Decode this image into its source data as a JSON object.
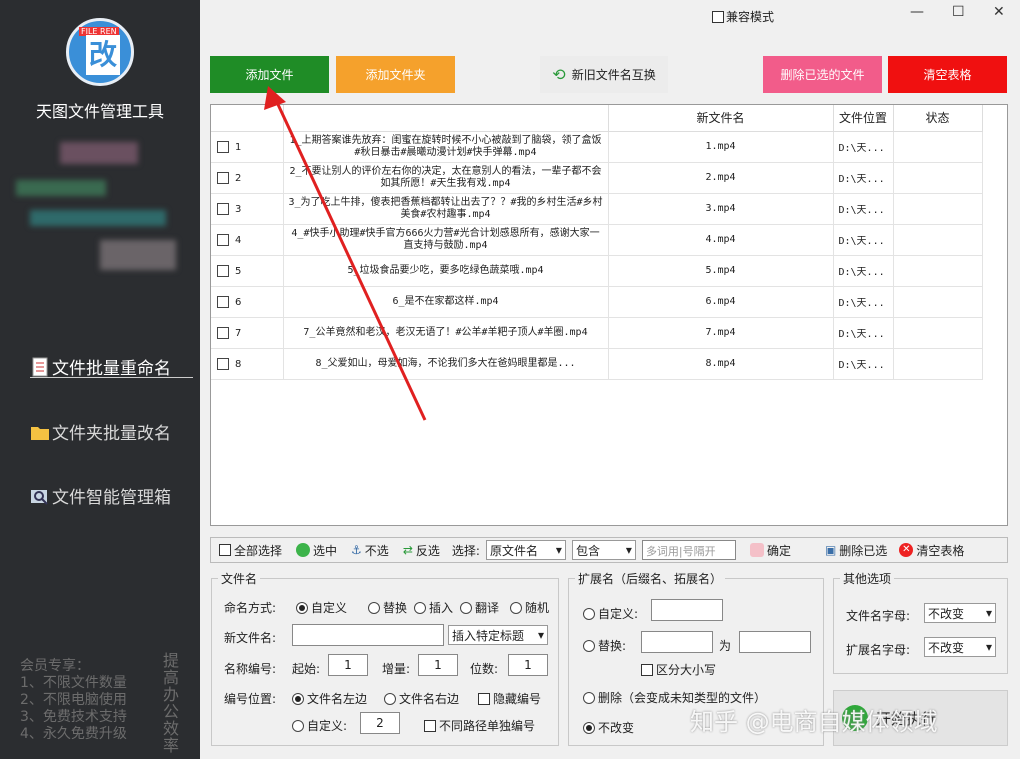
{
  "app": {
    "logo_tag": "FILE REN",
    "logo_char": "改",
    "title": "天图文件管理工具"
  },
  "nav": [
    {
      "label": "文件批量重命名"
    },
    {
      "label": "文件夹批量改名"
    },
    {
      "label": "文件智能管理箱"
    }
  ],
  "member": {
    "lines": [
      "会员专享：",
      "1、不限文件数量",
      "2、不限电脑使用",
      "3、免费技术支持",
      "4、永久免费升级"
    ],
    "side": "提高办公效率"
  },
  "window": {
    "compat": "兼容模式",
    "min": "—",
    "max": "☐",
    "close": "✕"
  },
  "buttons": {
    "add_file": "添加文件",
    "add_folder": "添加文件夹",
    "swap": "新旧文件名互换",
    "delete_selected": "删除已选的文件",
    "clear": "清空表格"
  },
  "colors": {
    "add_file": "#1f8c26",
    "add_folder": "#f5a12c",
    "delete_selected": "#f25c8a",
    "clear": "#f01010"
  },
  "table": {
    "headers": [
      "",
      "新文件名",
      "文件位置",
      "状态"
    ],
    "rows": [
      {
        "n": "1",
        "orig": "1_上期答案谁先放弃：闺蜜在旋转时候不小心被敲到了脑袋，领了盒饭#秋日暴击#晨曦动漫计划#快手弹幕.mp4",
        "new": "1.mp4",
        "loc": "D:\\天...",
        "status": ""
      },
      {
        "n": "2",
        "orig": "2_不要让别人的评价左右你的决定，太在意别人的看法，一辈子都不会如其所愿！#天生我有戏.mp4",
        "new": "2.mp4",
        "loc": "D:\\天...",
        "status": ""
      },
      {
        "n": "3",
        "orig": "3_为了吃上牛排，傻表把香蕉档都转让出去了？？#我的乡村生活#乡村美食#农村趣事.mp4",
        "new": "3.mp4",
        "loc": "D:\\天...",
        "status": ""
      },
      {
        "n": "4",
        "orig": "4_#快手小助理#快手官方666火力营#光合计划感恩所有，感谢大家一直支持与鼓励.mp4",
        "new": "4.mp4",
        "loc": "D:\\天...",
        "status": ""
      },
      {
        "n": "5",
        "orig": "5_垃圾食品要少吃，要多吃绿色蔬菜哦.mp4",
        "new": "5.mp4",
        "loc": "D:\\天...",
        "status": ""
      },
      {
        "n": "6",
        "orig": "6_是不在家都这样.mp4",
        "new": "6.mp4",
        "loc": "D:\\天...",
        "status": ""
      },
      {
        "n": "7",
        "orig": "7_公羊竟然和老汉，老汉无语了！#公羊#羊粑子顶人#羊圈.mp4",
        "new": "7.mp4",
        "loc": "D:\\天...",
        "status": ""
      },
      {
        "n": "8",
        "orig": "8_父爱如山，母爱如海，不论我们多大在爸妈眼里都是...",
        "new": "8.mp4",
        "loc": "D:\\天...",
        "status": ""
      }
    ]
  },
  "toolbar": {
    "select_all": "全部选择",
    "select": "选中",
    "unselect": "不选",
    "invert": "反选",
    "choose": "选择:",
    "field": "原文件名",
    "mode": "包含",
    "keyword_placeholder": "多词用|号隔开",
    "confirm": "确定",
    "delete_selected": "删除已选",
    "clear": "清空表格"
  },
  "filename": {
    "title": "文件名",
    "naming_label": "命名方式:",
    "modes": [
      "自定义",
      "替换",
      "插入",
      "翻译",
      "随机"
    ],
    "new_name_label": "新文件名:",
    "insert_title": "插入特定标题",
    "number_label": "名称编号:",
    "start_label": "起始:",
    "start": "1",
    "inc_label": "增量:",
    "inc": "1",
    "digits_label": "位数:",
    "digits": "1",
    "pos_label": "编号位置:",
    "pos_left": "文件名左边",
    "pos_right": "文件名右边",
    "hide_num": "隐藏编号",
    "custom": "自定义:",
    "custom_val": "2",
    "separate": "不同路径单独编号"
  },
  "ext": {
    "title": "扩展名（后缀名、拓展名）",
    "custom": "自定义:",
    "replace": "替换:",
    "for": "为",
    "case": "区分大小写",
    "delete": "删除（会变成未知类型的文件）",
    "keep": "不改变"
  },
  "other": {
    "title": "其他选项",
    "fn_case_label": "文件名字母:",
    "fn_case": "不改变",
    "ext_case_label": "扩展名字母:",
    "ext_case": "不改变"
  },
  "start_btn": "开始执行",
  "watermark": "知乎 @电商自媒体领域"
}
